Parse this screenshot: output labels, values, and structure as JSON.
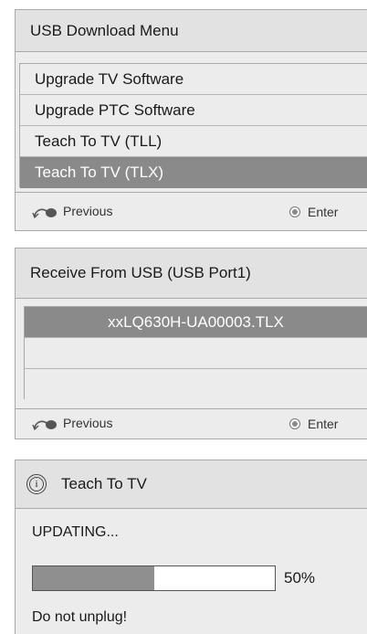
{
  "usb_menu": {
    "title": "USB Download Menu",
    "items": [
      {
        "label": "Upgrade TV Software",
        "selected": false
      },
      {
        "label": "Upgrade PTC Software",
        "selected": false
      },
      {
        "label": "Teach To TV (TLL)",
        "selected": false
      },
      {
        "label": "Teach To TV (TLX)",
        "selected": true
      }
    ],
    "footer": {
      "previous": "Previous",
      "enter": "Enter"
    }
  },
  "receive_usb": {
    "title": "Receive From USB (USB Port1)",
    "files": [
      "xxLQ630H-UA00003.TLX",
      "",
      ""
    ],
    "footer": {
      "previous": "Previous",
      "enter": "Enter"
    }
  },
  "teach_dialog": {
    "title": "Teach To TV",
    "status": "UPDATING...",
    "progress_percent": 50,
    "progress_label": "50%",
    "warning": "Do not unplug!"
  },
  "colors": {
    "selected_bg": "#8a8a8a",
    "panel_bg": "#ececec",
    "title_bg": "#e2e2e2",
    "progress_fill": "#8f8f8f"
  },
  "icons": {
    "previous": "return-arrow-icon",
    "enter": "enter-radio-icon",
    "info": "info-icon"
  }
}
